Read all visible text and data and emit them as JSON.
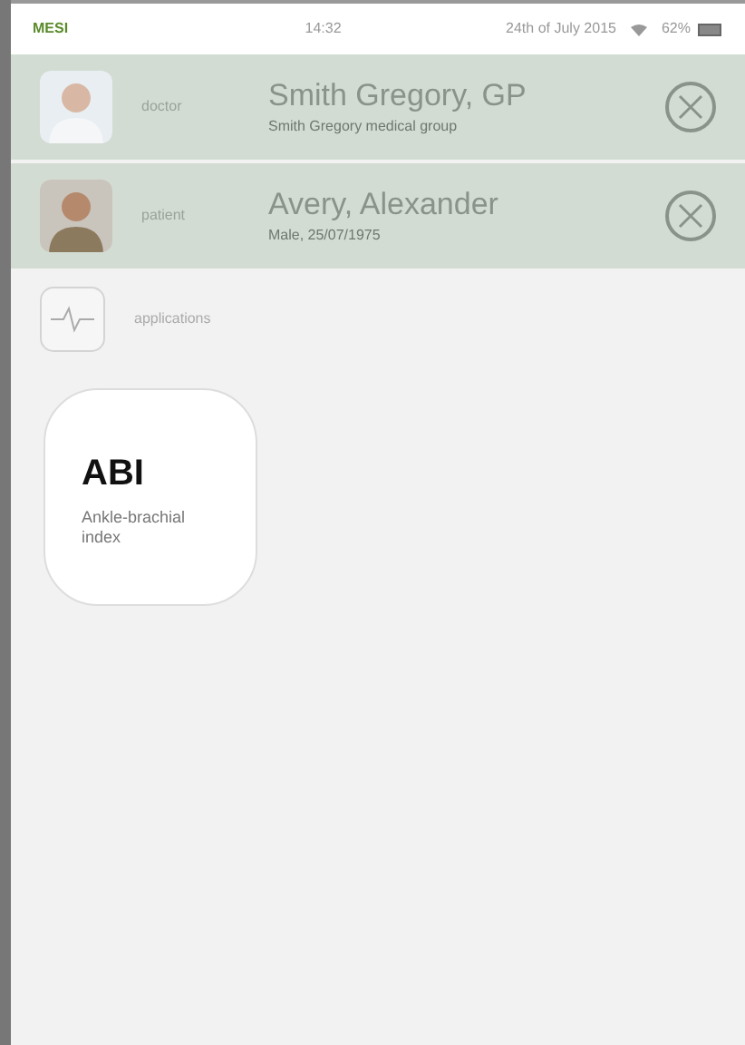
{
  "status_bar": {
    "carrier": "MESI",
    "time": "14:32",
    "date": "24th of July 2015",
    "battery": "62%"
  },
  "sessions": [
    {
      "role": "doctor",
      "name": "Smith Gregory, GP",
      "detail": "Smith Gregory medical group"
    },
    {
      "role": "patient",
      "name": "Avery, Alexander",
      "detail": "Male, 25/07/1975"
    }
  ],
  "section": {
    "label": "applications"
  },
  "apps": [
    {
      "title": "ABI",
      "subtitle": "Ankle-brachial index"
    }
  ]
}
